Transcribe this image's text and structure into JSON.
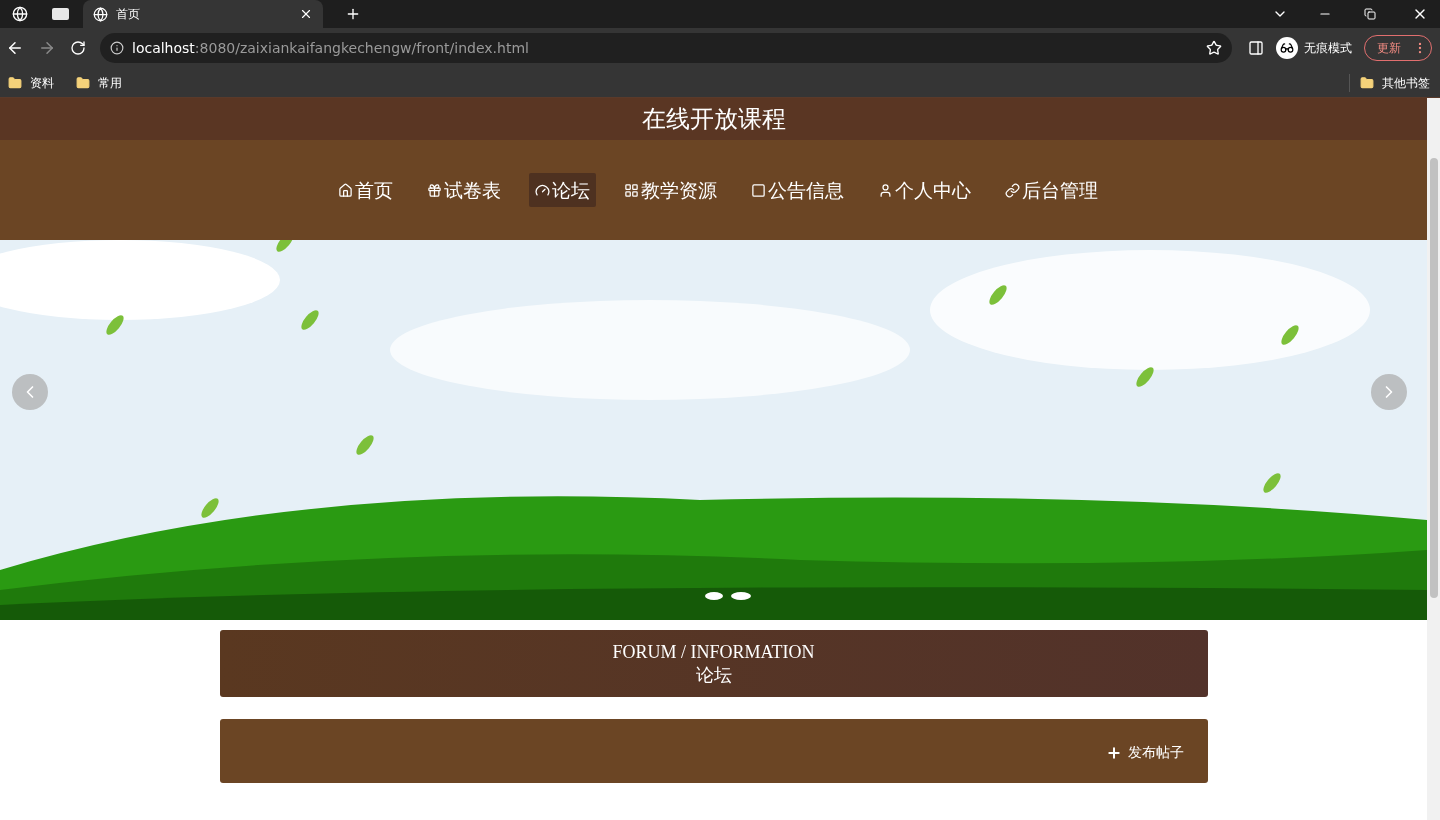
{
  "browser": {
    "tab_title": "首页",
    "url_host": "localhost",
    "url_path": ":8080/zaixiankaifangkechengw/front/index.html",
    "profile_label": "无痕模式",
    "update_button": "更新",
    "bookmarks": [
      {
        "label": "资料"
      },
      {
        "label": "常用"
      }
    ],
    "other_bookmarks": "其他书签"
  },
  "site": {
    "title": "在线开放课程"
  },
  "nav": [
    {
      "label": "首页",
      "selected": false
    },
    {
      "label": "试卷表",
      "selected": false
    },
    {
      "label": "论坛",
      "selected": true
    },
    {
      "label": "教学资源",
      "selected": false
    },
    {
      "label": "公告信息",
      "selected": false
    },
    {
      "label": "个人中心",
      "selected": false
    },
    {
      "label": "后台管理",
      "selected": false
    }
  ],
  "section_header": {
    "subtitle": "FORUM / INFORMATION",
    "title": "论坛"
  },
  "action_bar": {
    "button": "发布帖子"
  }
}
